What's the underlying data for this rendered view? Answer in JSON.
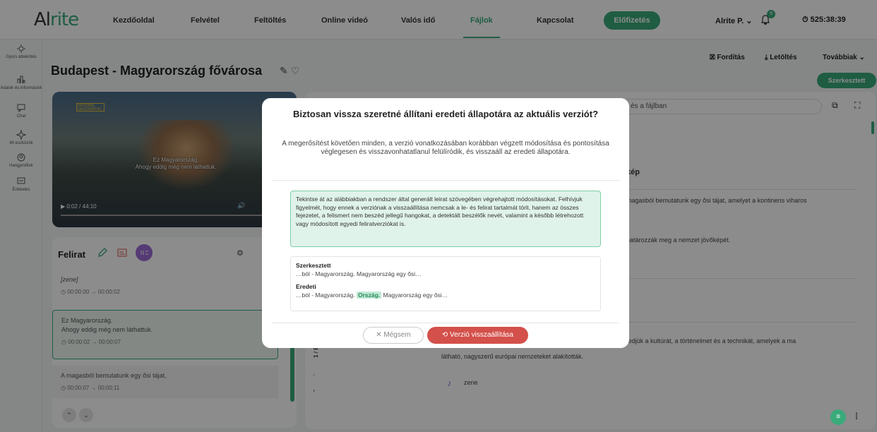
{
  "app": {
    "logo_a": "Al",
    "logo_b": "rite"
  },
  "nav": [
    "Kezdőoldal",
    "Felvétel",
    "Feltöltés",
    "Online videó",
    "Valós idő",
    "Fájlok",
    "Kapcsolat"
  ],
  "subscribe_label": "Előfizetés",
  "user_label": "Alrite P. ⌄",
  "bell_count": "9",
  "timer": "525:38:39",
  "sidebar": [
    {
      "label": "Gyors áttekintés"
    },
    {
      "label": "Adatok és információk"
    },
    {
      "label": "Chat"
    },
    {
      "label": "MI eszközök"
    },
    {
      "label": "Hangprofilok"
    },
    {
      "label": "Értékelés"
    }
  ],
  "page": {
    "title": "Budapest - Magyarország fővárosa",
    "translate": "Fordítás",
    "download": "Letöltés",
    "more": "Továbbiak ⌄",
    "edited": "Szerkesztett"
  },
  "video": {
    "badge": "NATIONAL GEOGRAPHIC",
    "caption1": "Ez Magyarország.",
    "caption2": "Ahogy eddig még nem láthattuk.",
    "time": "0:02 / 44:10"
  },
  "felirat": {
    "title": "Felirat",
    "segments": [
      {
        "text": "[zene]",
        "time": "00:00:00 → 00:00:02"
      },
      {
        "text": "Ez Magyarország.\nAhogy eddig még nem láthattuk.",
        "time": "00:00:02 → 00:00:07"
      },
      {
        "text": "A magasból bemutatunk egy ősi tájat,",
        "time": "00:00:07 → 00:00:11"
      }
    ]
  },
  "right": {
    "search_placeholder": "és a fájlban",
    "section": "kép",
    "t1": "magasból bemutatunk egy ősi tájat, amelyet a kontinens viharos",
    "t2": "határozzák meg a nemzet jövőképét.",
    "t3": "fedjük a kultúrát, a történelmet és a technikát, amelyek a ma",
    "t4": "látható, nagyszerű európai nemzeteket alakították.",
    "t5": "zene",
    "page_ind": "1 / B"
  },
  "modal": {
    "title": "Biztosan vissza szeretné állítani eredeti állapotára az aktuális verziót?",
    "desc": "A megerősítést követően minden, a verzió vonatkozásában korábban végzett módosítása és pontosítása véglegesen és visszavonhatatlanul felülíródik, és visszaáll az eredeti állapotára.",
    "info": "Tekintse át az alábbiakban a rendszer által generált leirat szövegében végrehajtott módosításokat. Felhívjuk figyelmét, hogy ennek a verziónak a visszaállítása nemcsak a le- és felirat tartalmát törli, hanem az összes fejezetet, a felismert nem beszéd jellegű hangokat, a detektált beszélők nevét, valamint a később létrehozott vagy módosított egyedi feliratverziókat is.",
    "edited_label": "Szerkesztett",
    "edited_value": "…ból - Magyarország. Magyarország egy ősi…",
    "orig_label": "Eredeti",
    "orig_pre": "…ból - Magyarország. ",
    "orig_hl": "Ország.",
    "orig_post": " Magyarország egy ősi…",
    "cancel": "✕  Mégsem",
    "restore": "⟲  Verzió visszaállítása"
  }
}
